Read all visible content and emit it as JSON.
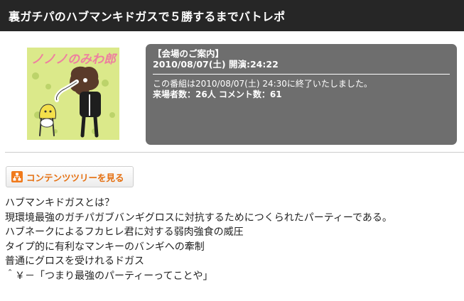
{
  "header": {
    "title": "裏ガチパのハブマンキドガスで５勝するまでバトレポ"
  },
  "thumbnail": {
    "caption": "ノノノのみわ郎",
    "icon": "community-thumbnail"
  },
  "info": {
    "heading": "【会場のご案内】",
    "datetime": "2010/08/07(土) 開演:24:22",
    "status": "この番組は2010/08/07(土) 24:30に終了いたしました。",
    "stats": "来場者数：26人 コメント数：61"
  },
  "content_tree_button": {
    "label": "コンテンツツリーを見る",
    "icon": "tree-icon"
  },
  "description": {
    "lines": [
      "ハブマンキドガスとは？",
      "現環境最強のガチパガブバンギグロスに対抗するためにつくられたパーティーである。",
      "ハブネークによるフカヒレ君に対する弱肉強食の威圧",
      "タイプ的に有利なマンキーのバンギへの牽制",
      "普通にグロスを受けれるドガス",
      "＾￥－「つまり最強のパーティーってことや」"
    ]
  },
  "colors": {
    "header_bg": "#262626",
    "info_bg": "#6e6e6e",
    "accent": "#f07a1c",
    "thumb_bg": "#d9e887"
  }
}
